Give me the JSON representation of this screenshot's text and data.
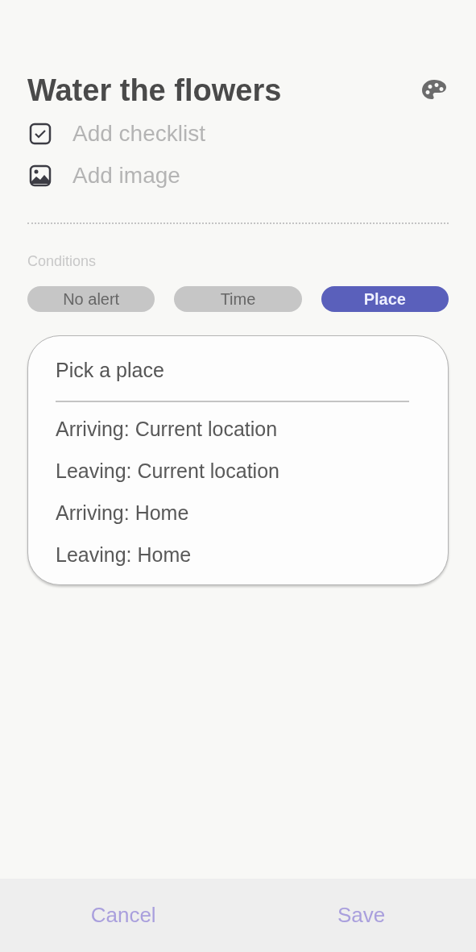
{
  "title": "Water the flowers",
  "actions": [
    {
      "kind": "checklist",
      "label": "Add checklist"
    },
    {
      "kind": "image",
      "label": "Add image"
    }
  ],
  "conditions": {
    "label": "Conditions",
    "options": [
      {
        "label": "No alert",
        "selected": false
      },
      {
        "label": "Time",
        "selected": false
      },
      {
        "label": "Place",
        "selected": true
      }
    ]
  },
  "place_menu": {
    "title": "Pick a place",
    "items": [
      "Arriving: Current location",
      "Leaving: Current location",
      "Arriving: Home",
      "Leaving: Home"
    ]
  },
  "buttons": [
    "Cancel",
    "Save"
  ]
}
